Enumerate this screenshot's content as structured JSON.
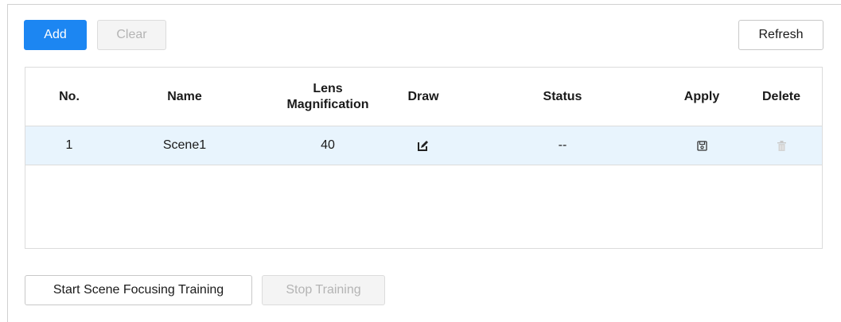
{
  "toolbar": {
    "add_label": "Add",
    "clear_label": "Clear",
    "refresh_label": "Refresh"
  },
  "table": {
    "headers": {
      "no": "No.",
      "name": "Name",
      "lens_line1": "Lens",
      "lens_line2": "Magnification",
      "draw": "Draw",
      "status": "Status",
      "apply": "Apply",
      "delete": "Delete"
    },
    "rows": [
      {
        "no": "1",
        "name": "Scene1",
        "lens_magnification": "40",
        "draw_icon": "edit-icon",
        "status": "--",
        "apply_icon": "save-icon",
        "delete_icon": "trash-icon"
      }
    ]
  },
  "footer": {
    "start_label": "Start Scene Focusing Training",
    "stop_label": "Stop Training"
  },
  "colors": {
    "primary": "#1c86f2",
    "row_highlight": "#e8f4fd",
    "disabled_text": "#b4b4b4"
  }
}
